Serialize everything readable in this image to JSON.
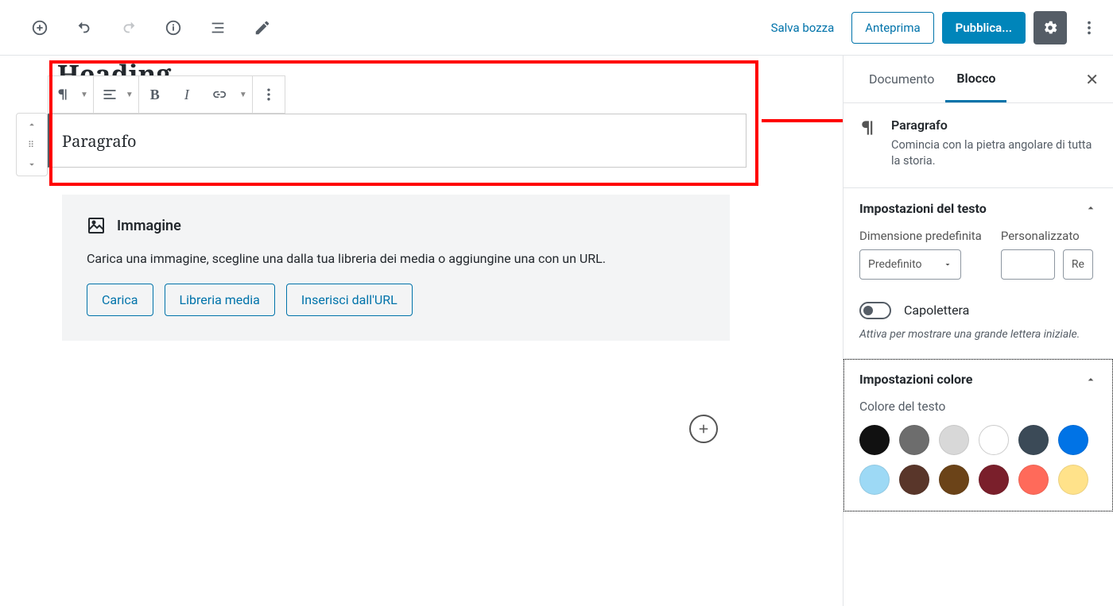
{
  "topbar": {
    "save_draft": "Salva bozza",
    "preview": "Anteprima",
    "publish": "Pubblica..."
  },
  "editor": {
    "heading_placeholder": "Heading",
    "paragraph_content": "Paragrafo"
  },
  "image_block": {
    "title": "Immagine",
    "desc": "Carica una immagine, scegline una dalla tua libreria dei media o aggiungine una con un URL.",
    "upload": "Carica",
    "media_library": "Libreria media",
    "insert_url": "Inserisci dall'URL"
  },
  "sidebar": {
    "tabs": {
      "document": "Documento",
      "block": "Blocco"
    },
    "block_info": {
      "title": "Paragrafo",
      "desc": "Comincia con la pietra angolare di tutta la storia."
    },
    "text_settings": {
      "heading": "Impostazioni del testo",
      "default_size_label": "Dimensione predefinita",
      "default_size_value": "Predefinito",
      "custom_label": "Personalizzato",
      "reset": "Re",
      "dropcap_label": "Capolettera",
      "dropcap_help": "Attiva per mostrare una grande lettera iniziale."
    },
    "color_settings": {
      "heading": "Impostazioni colore",
      "text_color_label": "Colore del testo",
      "colors": [
        "#111111",
        "#6d6d6d",
        "#d8d8d8",
        "#ffffff",
        "#3b4a57",
        "#0073e6",
        "#9dd9f5",
        "#59362a",
        "#6b4318",
        "#7a1f2b",
        "#ff6a5a",
        "#ffe28a"
      ]
    }
  }
}
